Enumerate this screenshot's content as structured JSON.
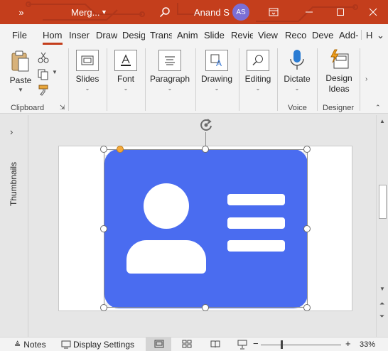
{
  "titlebar": {
    "quick_access": "»",
    "doc_title": "Merg...",
    "user_name": "Anand S",
    "user_initials": "AS",
    "accent": "#c43e1c"
  },
  "tabs": [
    {
      "label": "File"
    },
    {
      "label": "Hom"
    },
    {
      "label": "Inser"
    },
    {
      "label": "Draw"
    },
    {
      "label": "Desig"
    },
    {
      "label": "Trans"
    },
    {
      "label": "Anim"
    },
    {
      "label": "Slide"
    },
    {
      "label": "Revie"
    },
    {
      "label": "View"
    },
    {
      "label": "Reco"
    },
    {
      "label": "Deve"
    },
    {
      "label": "Add-"
    },
    {
      "label": "H"
    }
  ],
  "ribbon": {
    "paste": "Paste",
    "clipboard_group": "Clipboard",
    "slides": "Slides",
    "font": "Font",
    "paragraph": "Paragraph",
    "drawing": "Drawing",
    "editing": "Editing",
    "dictate": "Dictate",
    "voice_group": "Voice",
    "design_ideas_line1": "Design",
    "design_ideas_line2": "Ideas",
    "designer_group": "Designer"
  },
  "sidebar": {
    "thumbnails": "Thumbnails"
  },
  "slide": {
    "card_color": "#4a6cf0"
  },
  "statusbar": {
    "notes": "Notes",
    "display_settings": "Display Settings",
    "zoom_minus": "−",
    "zoom_plus": "+",
    "zoom_level": "33%"
  }
}
